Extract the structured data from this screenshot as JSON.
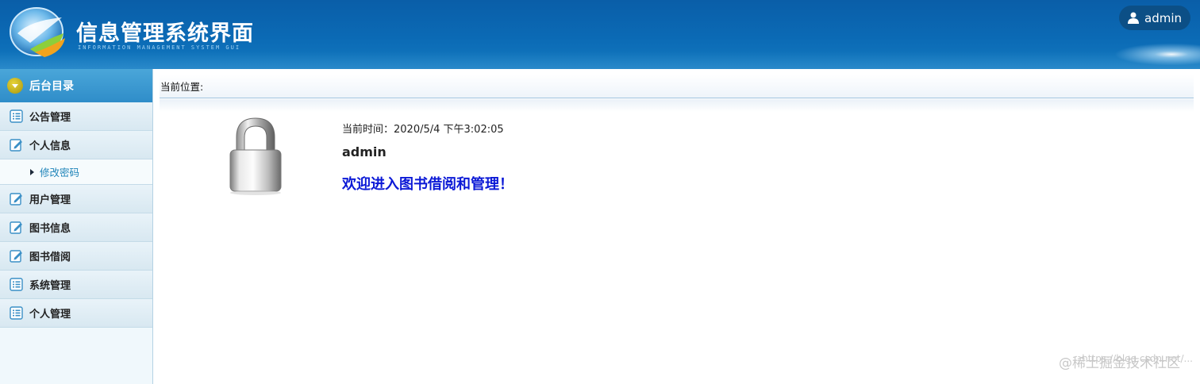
{
  "header": {
    "title": "信息管理系统界面",
    "subtitle": "INFORMATION MANAGEMENT SYSTEM GUI",
    "user": "admin",
    "user_icon": "user-icon",
    "logo_icon": "globe-logo-icon"
  },
  "sidebar": {
    "heading": "后台目录",
    "heading_icon": "chevron-down-circle-icon",
    "items": [
      {
        "label": "公告管理",
        "icon": "list-icon"
      },
      {
        "label": "个人信息",
        "icon": "edit-icon"
      },
      {
        "label": "修改密码",
        "icon": "triangle-right-icon",
        "sub": true
      },
      {
        "label": "用户管理",
        "icon": "edit-icon"
      },
      {
        "label": "图书信息",
        "icon": "edit-icon"
      },
      {
        "label": "图书借阅",
        "icon": "edit-icon"
      },
      {
        "label": "系统管理",
        "icon": "list-icon"
      },
      {
        "label": "个人管理",
        "icon": "list-icon"
      }
    ]
  },
  "main": {
    "breadcrumb": "当前位置:",
    "current_time": "当前时间：2020/5/4 下午3:02:05",
    "username": "admin",
    "welcome": "欢迎进入图书借阅和管理！",
    "lock_icon": "lock-icon"
  },
  "watermark": {
    "url": "https://blog.csdn.net/...",
    "text": "@稀土掘金技术社区"
  },
  "colors": {
    "header_blue": "#0b6ab5",
    "sidebar_head": "#2f8dc9",
    "welcome_blue": "#0b19d6",
    "sub_link": "#1f84b9"
  }
}
